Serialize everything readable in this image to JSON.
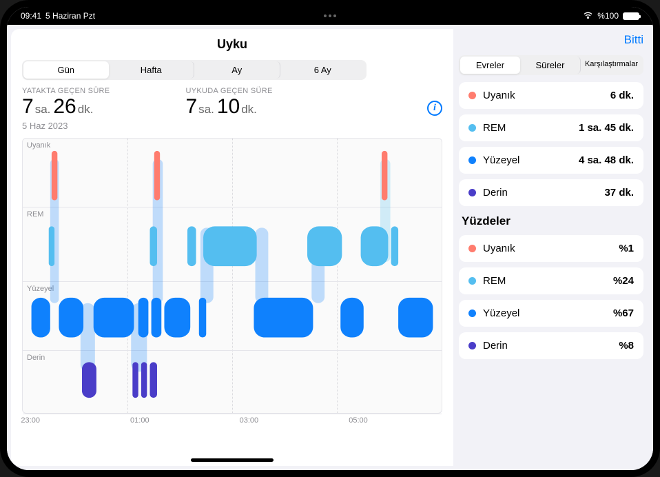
{
  "status_bar": {
    "time": "09:41",
    "date": "5 Haziran Pzt",
    "battery_text": "%100"
  },
  "header": {
    "title": "Uyku",
    "done": "Bitti"
  },
  "tabs_time": {
    "day": "Gün",
    "week": "Hafta",
    "month": "Ay",
    "six_month": "6 Ay"
  },
  "tabs_side": {
    "phases": "Evreler",
    "durations": "Süreler",
    "comparisons": "Karşılaştırmalar"
  },
  "stats": {
    "time_in_bed_label": "YATAKTA GEÇEN SÜRE",
    "time_in_bed_h": "7",
    "time_in_bed_h_unit": "sa.",
    "time_in_bed_m": "26",
    "time_in_bed_m_unit": "dk.",
    "asleep_label": "UYKUDA GEÇEN SÜRE",
    "asleep_h": "7",
    "asleep_h_unit": "sa.",
    "asleep_m": "10",
    "asleep_m_unit": "dk.",
    "date": "5 Haz 2023"
  },
  "chart_rows": {
    "awake": "Uyanık",
    "rem": "REM",
    "core": "Yüzeyel",
    "deep": "Derin"
  },
  "x_axis": [
    "23:00",
    "01:00",
    "03:00",
    "05:00"
  ],
  "colors": {
    "awake": "#ff7c6e",
    "rem": "#54bef0",
    "core": "#0f81fd",
    "deep": "#4a3dc8"
  },
  "phases": [
    {
      "name": "Uyanık",
      "value": "6 dk.",
      "color": "#ff7c6e"
    },
    {
      "name": "REM",
      "value": "1 sa. 45 dk.",
      "color": "#54bef0"
    },
    {
      "name": "Yüzeyel",
      "value": "4 sa. 48 dk.",
      "color": "#0f81fd"
    },
    {
      "name": "Derin",
      "value": "37 dk.",
      "color": "#4a3dc8"
    }
  ],
  "pct_header": "Yüzdeler",
  "percentages": [
    {
      "name": "Uyanık",
      "value": "%1",
      "color": "#ff7c6e"
    },
    {
      "name": "REM",
      "value": "%24",
      "color": "#54bef0"
    },
    {
      "name": "Yüzeyel",
      "value": "%67",
      "color": "#0f81fd"
    },
    {
      "name": "Derin",
      "value": "%8",
      "color": "#4a3dc8"
    }
  ],
  "chart_data": {
    "type": "other",
    "x_range": [
      "23:00",
      "06:30"
    ],
    "y_levels": [
      "Uyanık",
      "REM",
      "Yüzeyel",
      "Derin"
    ],
    "series": [
      {
        "phase": "Yüzeyel",
        "start": "23:00",
        "end": "23:15"
      },
      {
        "phase": "REM",
        "start": "23:15",
        "end": "23:18"
      },
      {
        "phase": "Uyanık",
        "start": "23:18",
        "end": "23:22"
      },
      {
        "phase": "Yüzeyel",
        "start": "23:25",
        "end": "23:48"
      },
      {
        "phase": "Derin",
        "start": "23:48",
        "end": "00:10"
      },
      {
        "phase": "Yüzeyel",
        "start": "00:10",
        "end": "00:42"
      },
      {
        "phase": "Derin",
        "start": "00:42",
        "end": "00:55"
      },
      {
        "phase": "Yüzeyel",
        "start": "00:55",
        "end": "01:10"
      },
      {
        "phase": "REM",
        "start": "01:10",
        "end": "01:13"
      },
      {
        "phase": "Uyanık",
        "start": "01:13",
        "end": "01:17"
      },
      {
        "phase": "Yüzeyel",
        "start": "01:20",
        "end": "01:40"
      },
      {
        "phase": "REM",
        "start": "01:40",
        "end": "01:45"
      },
      {
        "phase": "Yüzeyel",
        "start": "01:45",
        "end": "02:25"
      },
      {
        "phase": "REM",
        "start": "02:25",
        "end": "03:05"
      },
      {
        "phase": "Yüzeyel",
        "start": "03:05",
        "end": "03:55"
      },
      {
        "phase": "REM",
        "start": "03:55",
        "end": "04:30"
      },
      {
        "phase": "Yüzeyel",
        "start": "04:30",
        "end": "04:55"
      },
      {
        "phase": "REM",
        "start": "04:55",
        "end": "05:35"
      },
      {
        "phase": "Uyanık",
        "start": "05:35",
        "end": "05:38"
      },
      {
        "phase": "REM",
        "start": "05:40",
        "end": "05:48"
      },
      {
        "phase": "Yüzeyel",
        "start": "05:48",
        "end": "06:20"
      }
    ]
  }
}
